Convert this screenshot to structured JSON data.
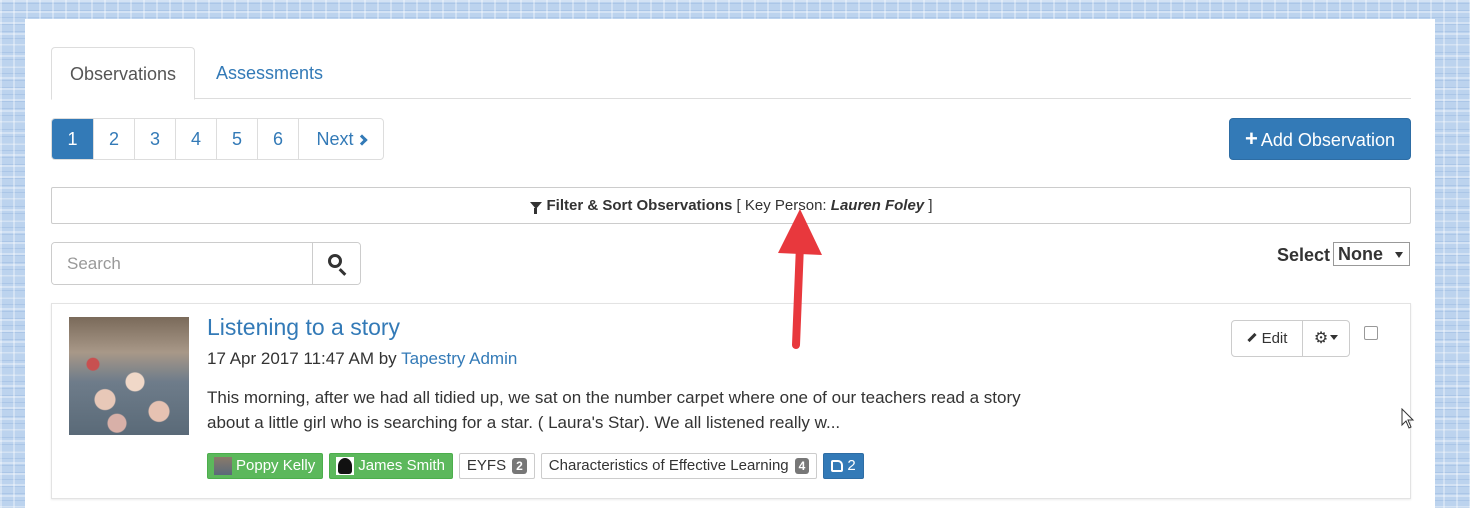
{
  "tabs": [
    {
      "label": "Observations",
      "active": true
    },
    {
      "label": "Assessments",
      "active": false
    }
  ],
  "pagination": {
    "pages": [
      "1",
      "2",
      "3",
      "4",
      "5",
      "6"
    ],
    "current": "1",
    "next_label": "Next"
  },
  "add_button_label": "Add Observation",
  "filter": {
    "label": "Filter & Sort Observations",
    "open_bracket": "[",
    "key_label": "Key Person:",
    "key_value": "Lauren Foley",
    "close_bracket": "]"
  },
  "search": {
    "placeholder": "Search"
  },
  "select": {
    "label": "Select",
    "value": "None"
  },
  "observation": {
    "title": "Listening to a story",
    "date": "17 Apr 2017 11:47 AM",
    "by": "by",
    "author": "Tapestry Admin",
    "body_line1": "This morning, after we had all tidied up, we sat on the number carpet where one of our teachers read a story",
    "body_line2": "about a little girl who is searching for a star. ( Laura's Star). We all listened really w...",
    "children": [
      {
        "name": "Poppy Kelly"
      },
      {
        "name": "James Smith"
      }
    ],
    "frameworks": [
      {
        "label": "EYFS",
        "count": "2"
      },
      {
        "label": "Characteristics of Effective Learning",
        "count": "4"
      }
    ],
    "likes": "2",
    "edit_label": "Edit"
  },
  "colors": {
    "primary": "#337ab7",
    "child_tag": "#5cb85c",
    "annotation_arrow": "#e8383d"
  }
}
